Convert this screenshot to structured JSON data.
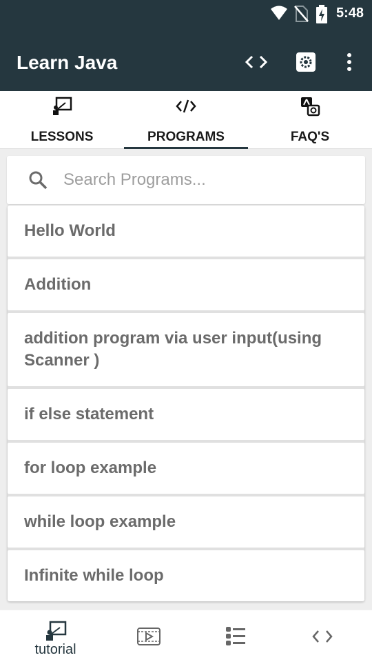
{
  "status_bar": {
    "time": "5:48",
    "icons": [
      "wifi-icon",
      "no-sim-icon",
      "battery-charging-icon"
    ]
  },
  "app_bar": {
    "title": "Learn Java",
    "actions": [
      "code-icon",
      "settings-icon",
      "more-vert-icon"
    ]
  },
  "tabs": [
    {
      "label": "LESSONS",
      "icon": "lesson-board-icon",
      "selected": false
    },
    {
      "label": "PROGRAMS",
      "icon": "code-slash-icon",
      "selected": true
    },
    {
      "label": "FAQ'S",
      "icon": "faq-translate-icon",
      "selected": false
    }
  ],
  "search": {
    "placeholder": "Search Programs...",
    "value": ""
  },
  "programs": [
    "Hello World",
    "Addition",
    "addition program via user input(using Scanner )",
    "if else statement",
    "for loop example",
    "while loop example",
    "Infinite while loop"
  ],
  "bottom_nav": {
    "items": [
      {
        "label": "tutorial",
        "icon": "tutorial-board-icon",
        "selected": true
      },
      {
        "label": "",
        "icon": "video-play-icon",
        "selected": false
      },
      {
        "label": "",
        "icon": "checklist-icon",
        "selected": false
      },
      {
        "label": "",
        "icon": "code-icon",
        "selected": false
      }
    ]
  },
  "colors": {
    "primary": "#25373f",
    "item_text": "#6b6b6b",
    "background": "#eeeeee"
  }
}
